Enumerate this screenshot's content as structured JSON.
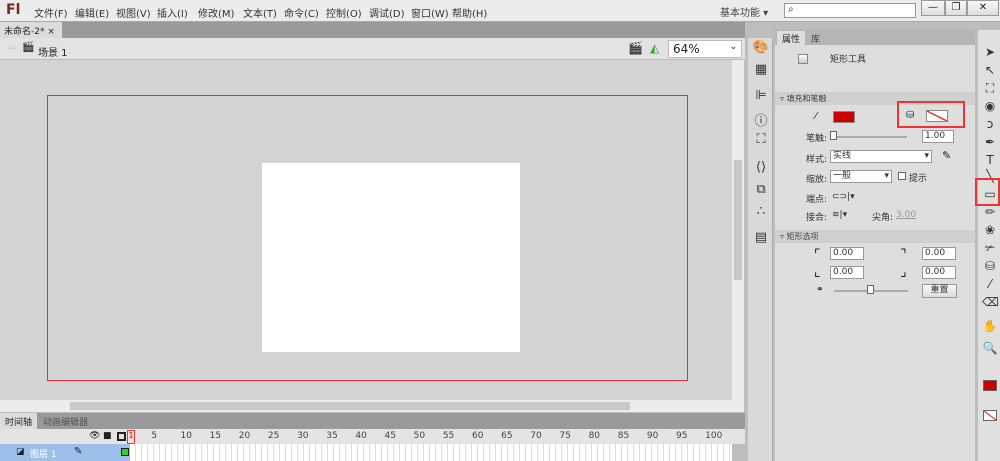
{
  "app": {
    "logo": "Fl",
    "menus": [
      "文件(F)",
      "编辑(E)",
      "视图(V)",
      "插入(I)",
      "修改(M)",
      "文本(T)",
      "命令(C)",
      "控制(O)",
      "调试(D)",
      "窗口(W)",
      "帮助(H)"
    ],
    "workspace": "基本功能",
    "search_placeholder": ""
  },
  "doc": {
    "tab": "未命名-2*",
    "scene": "场景 1",
    "zoom": "64%"
  },
  "timeline": {
    "tabs": [
      "时间轴",
      "动画编辑器"
    ],
    "layer": "图层 1",
    "current_frame": "1",
    "frame_numbers": [
      "5",
      "10",
      "15",
      "20",
      "25",
      "30",
      "35",
      "40",
      "45",
      "50",
      "55",
      "60",
      "65",
      "70",
      "75",
      "80",
      "85",
      "90",
      "95",
      "100"
    ]
  },
  "properties": {
    "tabs": [
      "属性",
      "库"
    ],
    "tool_name": "矩形工具",
    "fill_stroke": {
      "title": "填充和笔触",
      "stroke_color": "#cc0000",
      "fill": "none"
    },
    "stroke_label": "笔触:",
    "stroke_value": "1.00",
    "style_label": "样式:",
    "style_value": "实线",
    "scale_label": "缩放:",
    "scale_value": "一般",
    "hint_label": "提示",
    "cap_label": "端点:",
    "join_label": "接合:",
    "miter_label": "尖角:",
    "miter_value": "3.00",
    "rect_options": {
      "title": "矩形选项",
      "corners": [
        "0.00",
        "0.00",
        "0.00",
        "0.00"
      ],
      "reset": "重置"
    }
  },
  "colors": {
    "highlight": "#e33333",
    "stroke": "#cc0000"
  }
}
